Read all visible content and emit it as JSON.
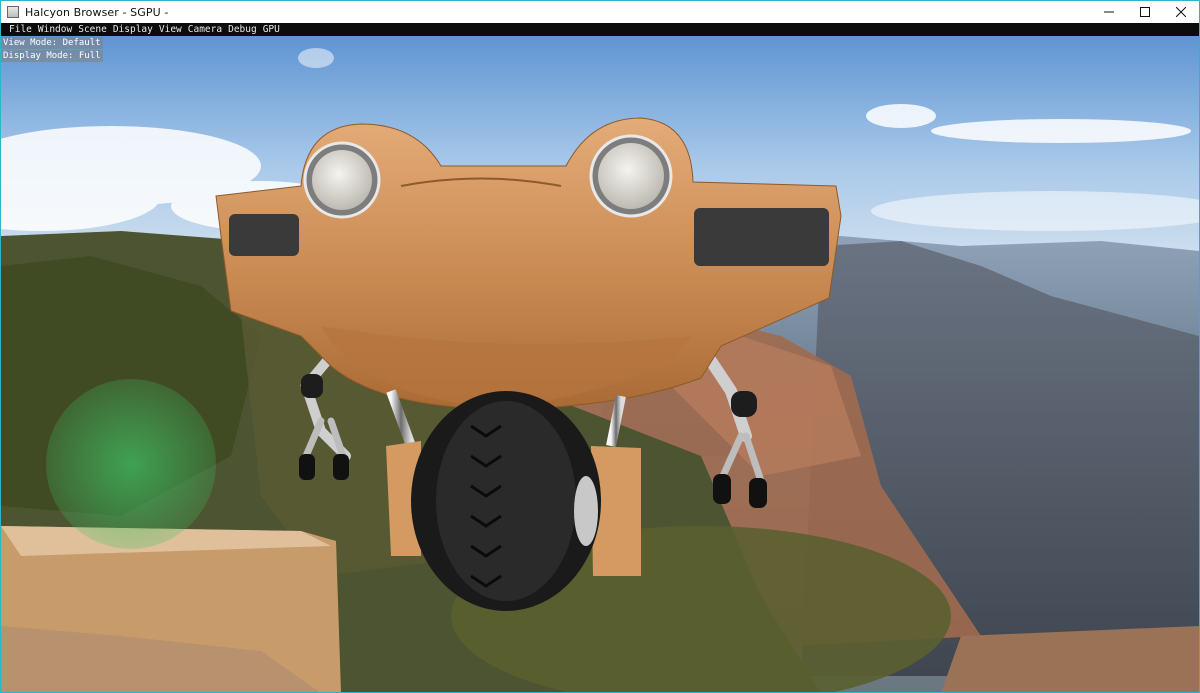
{
  "window": {
    "title": "Halcyon Browser - SGPU -",
    "controls": {
      "minimize": "minimize-icon",
      "maximize": "maximize-icon",
      "close": "close-icon"
    }
  },
  "menu": {
    "items": [
      "File",
      "Window",
      "Scene",
      "Display",
      "View",
      "Camera",
      "Debug",
      "GPU"
    ]
  },
  "viewport": {
    "view_mode": "View Mode: Default",
    "display_mode": "Display Mode: Full"
  },
  "colors": {
    "frame_accent": "#2ab7c7",
    "menubar_bg": "#0c0c0c",
    "robot_body": "#d2935a",
    "sky_top": "#6f9fd6"
  }
}
